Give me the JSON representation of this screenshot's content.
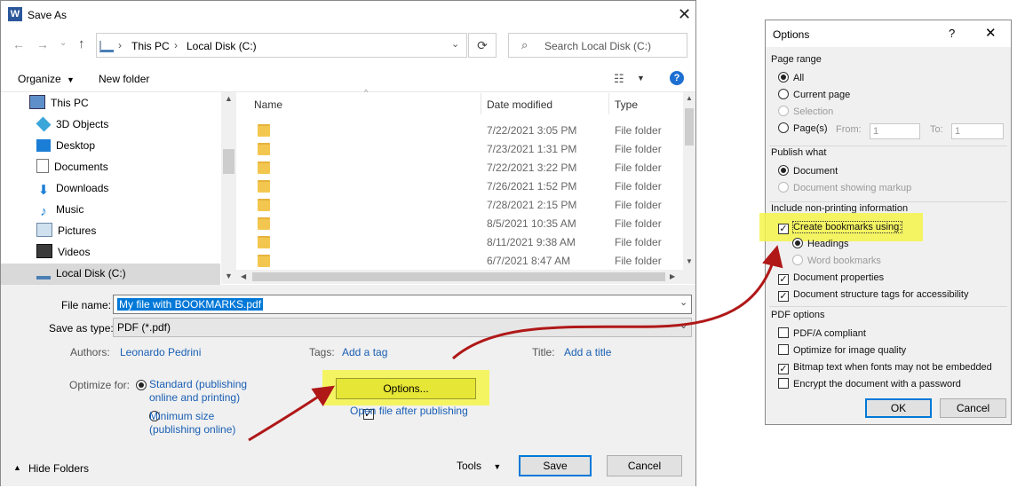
{
  "save_as": {
    "title": "Save As",
    "breadcrumb": [
      "This PC",
      "Local Disk (C:)"
    ],
    "search_placeholder": "Search Local Disk (C:)",
    "toolbar": {
      "organize": "Organize",
      "new_folder": "New folder"
    },
    "nav_tree": [
      {
        "label": "This PC",
        "icon": "computer-icon"
      },
      {
        "label": "3D Objects",
        "icon": "cube-icon"
      },
      {
        "label": "Desktop",
        "icon": "desktop-icon"
      },
      {
        "label": "Documents",
        "icon": "documents-icon"
      },
      {
        "label": "Downloads",
        "icon": "download-icon"
      },
      {
        "label": "Music",
        "icon": "music-icon"
      },
      {
        "label": "Pictures",
        "icon": "pictures-icon"
      },
      {
        "label": "Videos",
        "icon": "videos-icon"
      },
      {
        "label": "Local Disk (C:)",
        "icon": "drive-icon"
      }
    ],
    "columns": {
      "name": "Name",
      "date": "Date modified",
      "type": "Type"
    },
    "files": [
      {
        "date": "7/22/2021 3:05 PM",
        "type": "File folder"
      },
      {
        "date": "7/23/2021 1:31 PM",
        "type": "File folder"
      },
      {
        "date": "7/22/2021 3:22 PM",
        "type": "File folder"
      },
      {
        "date": "7/26/2021 1:52 PM",
        "type": "File folder"
      },
      {
        "date": "7/28/2021 2:15 PM",
        "type": "File folder"
      },
      {
        "date": "8/5/2021 10:35 AM",
        "type": "File folder"
      },
      {
        "date": "8/11/2021 9:38 AM",
        "type": "File folder"
      },
      {
        "date": "6/7/2021 8:47 AM",
        "type": "File folder"
      }
    ],
    "file_name_label": "File name:",
    "file_name_value": "My file with BOOKMARKS.pdf",
    "save_as_type_label": "Save as type:",
    "save_as_type_value": "PDF (*.pdf)",
    "authors_label": "Authors:",
    "authors_value": "Leonardo Pedrini",
    "tags_label": "Tags:",
    "tags_value": "Add a tag",
    "title_label": "Title:",
    "title_value": "Add a title",
    "optimize_label": "Optimize for:",
    "optimize_standard_1": "Standard (publishing",
    "optimize_standard_2": "online and printing)",
    "optimize_min_1": "Minimum size",
    "optimize_min_2": "(publishing online)",
    "options_button": "Options...",
    "open_after": "Open file after publishing",
    "hide_folders": "Hide Folders",
    "tools": "Tools",
    "save": "Save",
    "cancel": "Cancel"
  },
  "options_dialog": {
    "title": "Options",
    "help": "?",
    "page_range_label": "Page range",
    "all": "All",
    "current_page": "Current page",
    "selection": "Selection",
    "pages": "Page(s)",
    "from_label": "From:",
    "from_value": "1",
    "to_label": "To:",
    "to_value": "1",
    "publish_what_label": "Publish what",
    "document": "Document",
    "document_markup": "Document showing markup",
    "non_printing_label": "Include non-printing information",
    "create_bookmarks": "Create bookmarks using:",
    "headings": "Headings",
    "word_bookmarks": "Word bookmarks",
    "doc_properties": "Document properties",
    "doc_structure_tags": "Document structure tags for accessibility",
    "pdf_options_label": "PDF options",
    "pdfa": "PDF/A compliant",
    "optimize_image": "Optimize for image quality",
    "bitmap_text": "Bitmap text when fonts may not be embedded",
    "encrypt": "Encrypt the document with a password",
    "ok": "OK",
    "cancel": "Cancel"
  },
  "colors": {
    "highlight": "#f5f54a",
    "arrow": "#b01818",
    "link": "#1a5fb4",
    "selection": "#0078d7"
  }
}
